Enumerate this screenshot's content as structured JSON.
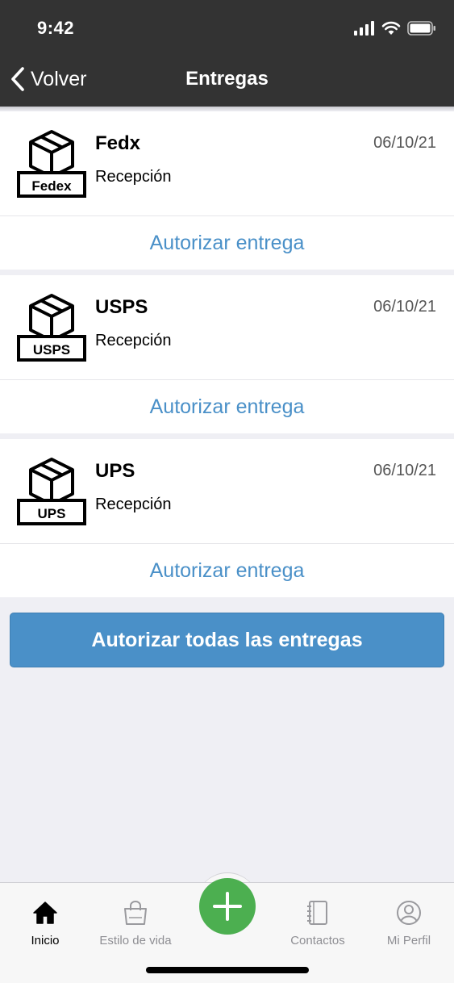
{
  "status_bar": {
    "time": "9:42",
    "icons": [
      "signal-icon",
      "wifi-icon",
      "battery-icon"
    ]
  },
  "nav": {
    "back_label": "Volver",
    "title": "Entregas"
  },
  "deliveries": [
    {
      "carrier": "Fedx",
      "logo_text": "Fedex",
      "date": "06/10/21",
      "status": "Recepción",
      "action": "Autorizar entrega"
    },
    {
      "carrier": "USPS",
      "logo_text": "USPS",
      "date": "06/10/21",
      "status": "Recepción",
      "action": "Autorizar entrega"
    },
    {
      "carrier": "UPS",
      "logo_text": "UPS",
      "date": "06/10/21",
      "status": "Recepción",
      "action": "Autorizar entrega"
    }
  ],
  "authorize_all": "Autorizar todas las entregas",
  "tabbar": {
    "items": [
      {
        "label": "Inicio",
        "icon": "home-icon",
        "active": true
      },
      {
        "label": "Estilo de vida",
        "icon": "shopping-bag-icon",
        "active": false
      },
      {
        "label": "",
        "icon": "plus-icon",
        "active": false
      },
      {
        "label": "Contactos",
        "icon": "address-book-icon",
        "active": false
      },
      {
        "label": "Mi Perfil",
        "icon": "user-icon",
        "active": false
      }
    ]
  },
  "colors": {
    "header": "#333333",
    "accent": "#4a90c8",
    "fab": "#4caf50",
    "background": "#efeff4"
  }
}
